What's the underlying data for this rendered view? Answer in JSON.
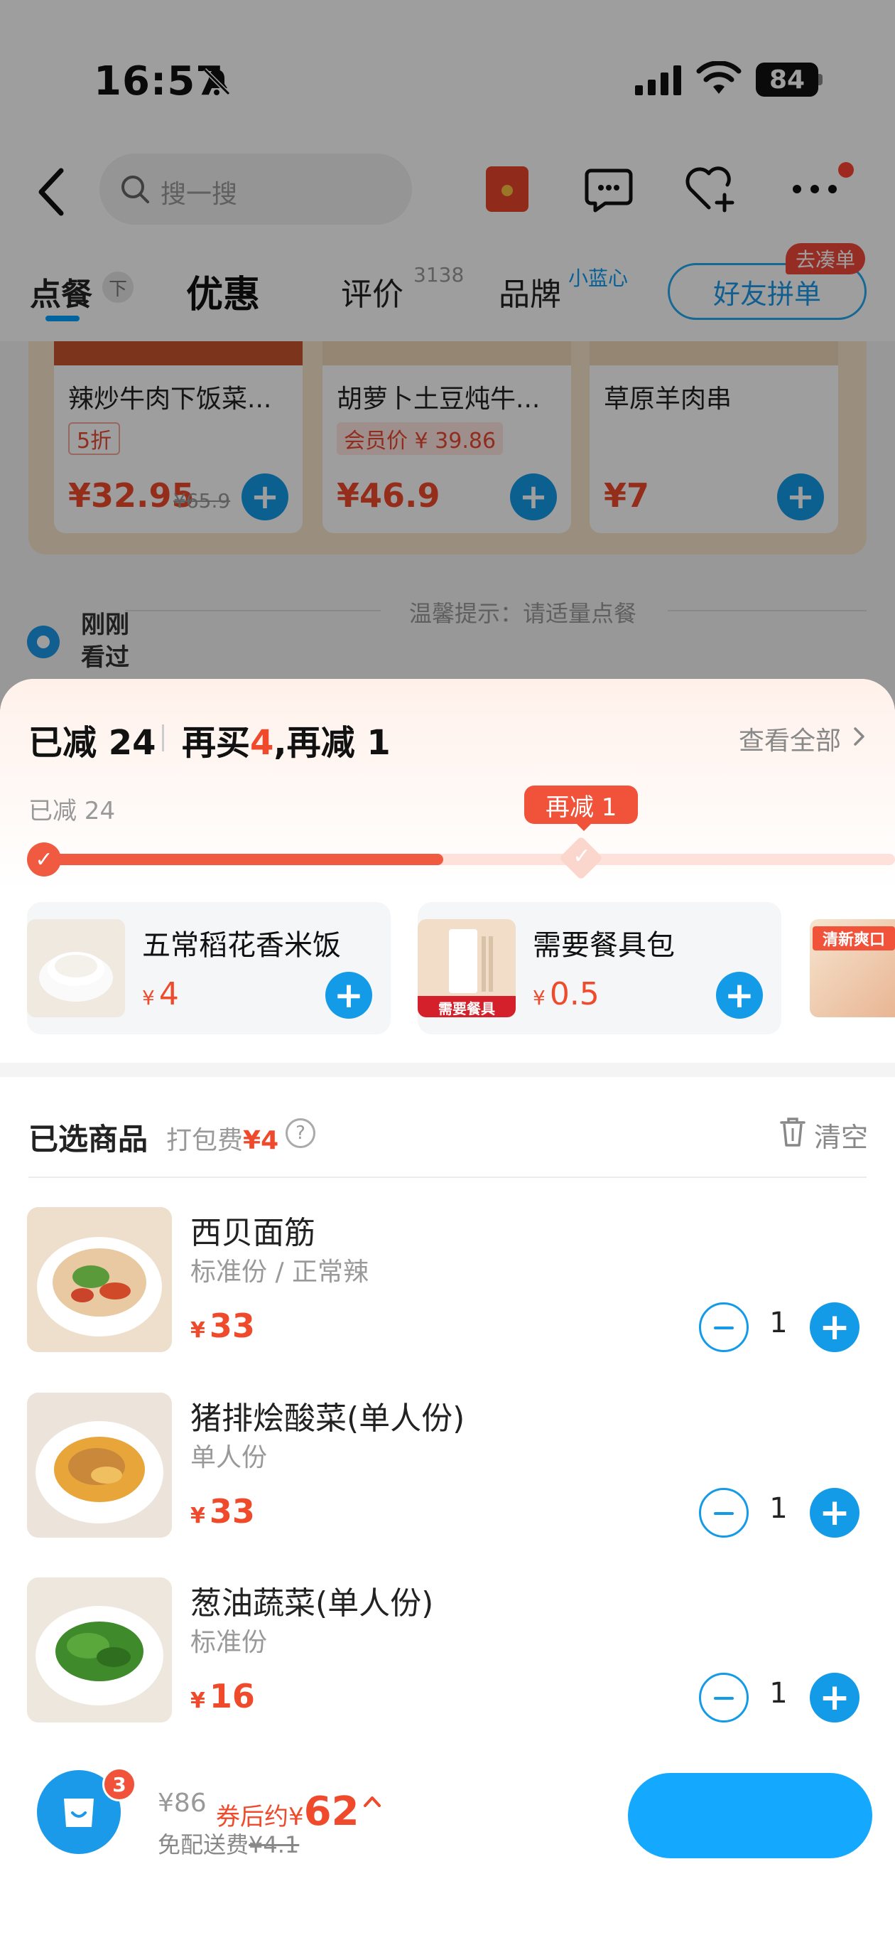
{
  "status_bar": {
    "time": "16:57",
    "battery": "84"
  },
  "search": {
    "placeholder": "搜一搜"
  },
  "tabs": {
    "order": "点餐",
    "pin": "下",
    "discount": "优惠",
    "review": "评价",
    "review_count": "3138",
    "brand": "品牌",
    "brand_sub": "小蓝心",
    "friend_group": "好友拼单",
    "go_bundle": "去凑单"
  },
  "recommend": [
    {
      "name": "辣炒牛肉下饭菜...",
      "tag": "5折",
      "price": "¥32.95",
      "orig": "¥65.9"
    },
    {
      "name": "胡萝卜土豆炖牛...",
      "tag": "会员价 ¥ 39.86",
      "price": "¥46.9",
      "orig": ""
    },
    {
      "name": "草原羊肉串",
      "tag": "",
      "price": "¥7",
      "orig": ""
    }
  ],
  "hint": "温馨提示：请适量点餐",
  "recent": "刚刚看过",
  "reduce": {
    "done": "已减 24",
    "more_prefix": "再买",
    "more_count": "4",
    "more_suffix": ",再减 1",
    "see_all": "查看全部",
    "progress_label": "已减 24",
    "bubble": "再减 1",
    "progress_fraction": 0.47
  },
  "upsell": [
    {
      "name": "五常稻花香米饭",
      "price": "4"
    },
    {
      "name": "需要餐具包",
      "price": "0.5",
      "img_tag": "需要餐具"
    }
  ],
  "upsell_partial_tag": "清新爽口",
  "selected": {
    "title": "已选商品",
    "pack_fee_label": "打包费",
    "pack_fee": "¥4",
    "help": "?",
    "clear": "清空",
    "items": [
      {
        "name": "西贝面筋",
        "spec": "标准份 / 正常辣",
        "price": "33",
        "qty": "1"
      },
      {
        "name": "猪排烩酸菜(单人份)",
        "spec": "单人份",
        "price": "33",
        "qty": "1"
      },
      {
        "name": "葱油蔬菜(单人份)",
        "spec": "标准份",
        "price": "16",
        "qty": "1"
      }
    ]
  },
  "bottom": {
    "cart_count": "3",
    "total_orig": "¥86",
    "after_label": "券后约",
    "after_yen": "¥",
    "after_value": "62",
    "delivery_label": "免配送费",
    "delivery_orig": "¥4.1",
    "checkout": ""
  },
  "currency": "¥",
  "colors": {
    "accent_blue": "#149be8",
    "price_red": "#f04a2c",
    "progress_red": "#f05a40"
  }
}
